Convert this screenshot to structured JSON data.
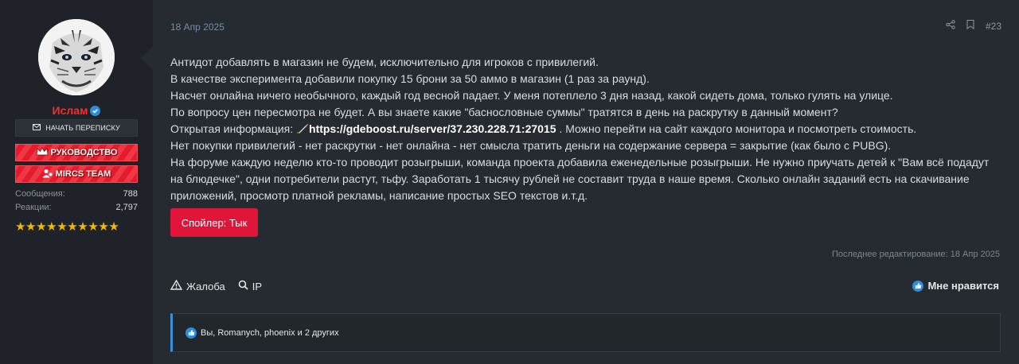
{
  "user": {
    "name": "Ислам",
    "message_button": "НАЧАТЬ ПЕРЕПИСКУ",
    "banners": [
      "РУКОВОДСТВО",
      "MIRCS TEAM"
    ],
    "stats": [
      {
        "label": "Сообщения:",
        "value": "788"
      },
      {
        "label": "Реакции:",
        "value": "2,797"
      }
    ],
    "stars": "★★★★★★★★★★",
    "name_color": "#ff2a2a"
  },
  "post": {
    "date": "18 Апр 2025",
    "number": "#23",
    "lines": [
      "Антидот добавлять в магазин не будем, исключительно для игроков с привилегий.",
      "В качестве эксперимента добавили покупку 15 брони за 50 аммо в магазин (1 раз за раунд).",
      "Насчет онлайна ничего необычного, каждый год весной падает. У меня потеплело 3 дня назад, какой сидеть дома, только гулять на улице.",
      "По вопросу цен пересмотра не будет. А вы знаете какие \"баснословные суммы\" тратятся в день на раскрутку в данный момент?"
    ],
    "info_prefix": "Открытая информация: ",
    "info_link": "https://gdeboost.ru/server/37.230.228.71:27015",
    "info_suffix": " . Можно перейти на сайт каждого монитора и посмотреть стоимость.",
    "lines2": [
      "Нет покупки привилегий - нет раскрутки - нет онлайна - нет смысла тратить деньги на содержание сервера = закрытие (как было с PUBG).",
      "На форуме каждую неделю кто-то проводит розыгрыши, команда проекта добавила еженедельные розыгрыши. Не нужно приучать детей к \"Вам всё подадут на блюдечке\", одни потребители растут, тьфу. Заработать 1 тысячу рублей не составит труда в наше время. Сколько онлайн заданий есть на скачивание приложений, просмотр платной рекламы, написание простых SEO текстов и.т.д."
    ],
    "spoiler_label": "Спойлер: Тык",
    "edited": "Последнее редактирование: 18 Апр 2025",
    "actions": {
      "report": "Жалоба",
      "ip": "IP",
      "like": "Мне нравится"
    },
    "reactions": "Вы, Romanych, phoenix и 2 других"
  },
  "colors": {
    "accent": "#e0153a",
    "like": "#2b8de0"
  }
}
